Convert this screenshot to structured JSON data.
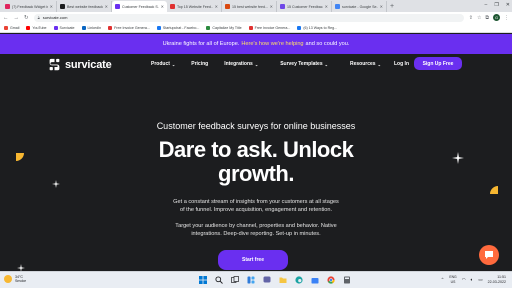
{
  "browser": {
    "tabs": [
      {
        "title": "(7) Feedback Widget in...",
        "favicon_color": "#e0245e",
        "active": false
      },
      {
        "title": "Best website feedback...",
        "favicon_color": "#1c1d1f",
        "active": false
      },
      {
        "title": "Customer Feedback S...",
        "favicon_color": "#6a2ff0",
        "active": true
      },
      {
        "title": "Top 15 Website Feed...",
        "favicon_color": "#e03131",
        "active": false
      },
      {
        "title": "15 best website feed...",
        "favicon_color": "#d9480f",
        "active": false
      },
      {
        "title": "15 Customer Feedbac...",
        "favicon_color": "#7048e8",
        "active": false
      },
      {
        "title": "survicate - Google Se...",
        "favicon_color": "#4285f4",
        "active": false
      }
    ],
    "new_tab_symbol": "+",
    "window_controls": [
      "–",
      "❐",
      "✕"
    ],
    "url": "survicate.com",
    "profile_initial": "G",
    "bookmarks": [
      {
        "label": "Gmail",
        "color": "#ea4335"
      },
      {
        "label": "YouTube",
        "color": "#ff0000"
      },
      {
        "label": "Survicate",
        "color": "#6a2ff0"
      },
      {
        "label": "LinkedIn",
        "color": "#0a66c2"
      },
      {
        "label": "Free Invoice Genera...",
        "color": "#e03131"
      },
      {
        "label": "Startupchat - Facebo...",
        "color": "#1877f2"
      },
      {
        "label": "Capitalize My Title",
        "color": "#2b8a3e"
      },
      {
        "label": "Free Invoice Genera...",
        "color": "#e03131"
      },
      {
        "label": "(6) 13 Ways to Reg...",
        "color": "#1877f2"
      }
    ]
  },
  "banner": {
    "lead": "Ukraine fights for all of Europe.",
    "link": "Here's how we're helping",
    "tail": "and so could you."
  },
  "nav": {
    "brand": "survicate",
    "items": [
      {
        "label": "Product",
        "has_caret": true
      },
      {
        "label": "Pricing",
        "has_caret": false
      },
      {
        "label": "Integrations",
        "has_caret": true
      },
      {
        "label": "Survey Templates",
        "has_caret": true
      },
      {
        "label": "Resources",
        "has_caret": true
      }
    ],
    "login": "Log In",
    "signup": "Sign Up Free"
  },
  "hero": {
    "eyebrow": "Customer feedback surveys for online businesses",
    "headline_line1": "Dare to ask. Unlock",
    "headline_line2": "growth.",
    "para1_line1": "Get a constant stream of insights from your customers at all stages",
    "para1_line2": "of the funnel. Improve acquisition, engagement and retention.",
    "para2_line1": "Target your audience by channel, properties and behavior. Native",
    "para2_line2": "integrations. Deep-dive reporting. Set-up in minutes.",
    "cta": "Start free"
  },
  "taskbar": {
    "weather_temp": "34°C",
    "weather_desc": "Smoke",
    "language_line1": "ENG",
    "language_line2": "US",
    "time": "11:51",
    "date": "22-03-2022"
  },
  "colors": {
    "brand_purple": "#6a2ff0",
    "page_dark": "#1c1d1f",
    "accent_yellow": "#ffe066",
    "chat_orange": "#ff6a3d"
  }
}
